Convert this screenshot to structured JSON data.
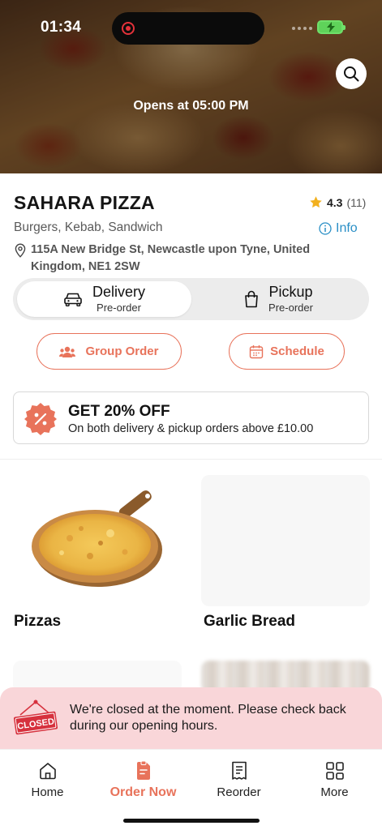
{
  "status_bar": {
    "time": "01:34"
  },
  "hero": {
    "opens_text": "Opens at 05:00 PM"
  },
  "store": {
    "name": "SAHARA PIZZA",
    "rating": "4.3",
    "rating_count": "(11)",
    "cuisines": "Burgers, Kebab, Sandwich",
    "info_label": "Info",
    "address": "115A New Bridge St, Newcastle upon Tyne, United Kingdom, NE1 2SW"
  },
  "order_type": {
    "options": [
      {
        "label": "Delivery",
        "sub": "Pre-order",
        "active": true
      },
      {
        "label": "Pickup",
        "sub": "Pre-order",
        "active": false
      }
    ]
  },
  "actions": {
    "group_order": "Group Order",
    "schedule": "Schedule"
  },
  "promo": {
    "title": "GET 20% OFF",
    "subtitle": "On both delivery & pickup orders above £10.00"
  },
  "categories": [
    {
      "name": "Pizzas"
    },
    {
      "name": "Garlic Bread"
    }
  ],
  "closed_banner": {
    "sign": "CLOSED",
    "message": "We're closed at the moment. Please check back during our opening hours."
  },
  "bottom_nav": {
    "items": [
      {
        "label": "Home",
        "icon": "home-icon"
      },
      {
        "label": "Order Now",
        "icon": "order-icon",
        "active": true
      },
      {
        "label": "Reorder",
        "icon": "receipt-icon"
      },
      {
        "label": "More",
        "icon": "grid-icon"
      }
    ]
  },
  "colors": {
    "accent": "#e8735b",
    "info_link": "#2a8fc6",
    "closed_bg": "#f9d6d9",
    "closed_sign": "#d6313d",
    "star": "#f2b01e"
  }
}
